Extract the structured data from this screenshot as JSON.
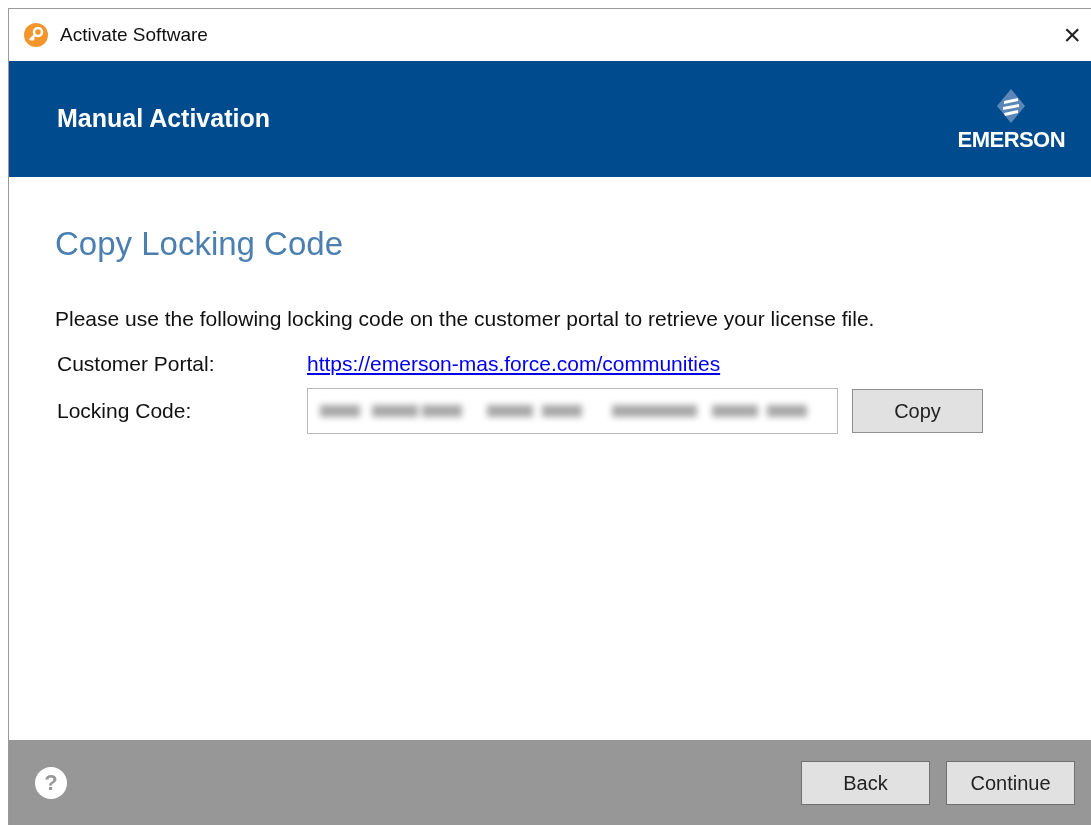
{
  "window": {
    "title": "Activate Software",
    "close": "×"
  },
  "header": {
    "title": "Manual Activation",
    "logo_text": "EMERSON"
  },
  "section_title": "Copy Locking Code",
  "instructions": "Please use the following locking code on the customer portal to retrieve your license file.",
  "fields": [
    {
      "kind": "link",
      "label": "Customer Portal:",
      "value": "https://emerson-mas.force.com/communities"
    },
    {
      "kind": "code",
      "label": "Locking Code:",
      "button": "Copy"
    }
  ],
  "footer": {
    "help": "?",
    "buttons": [
      "Back",
      "Continue"
    ]
  }
}
